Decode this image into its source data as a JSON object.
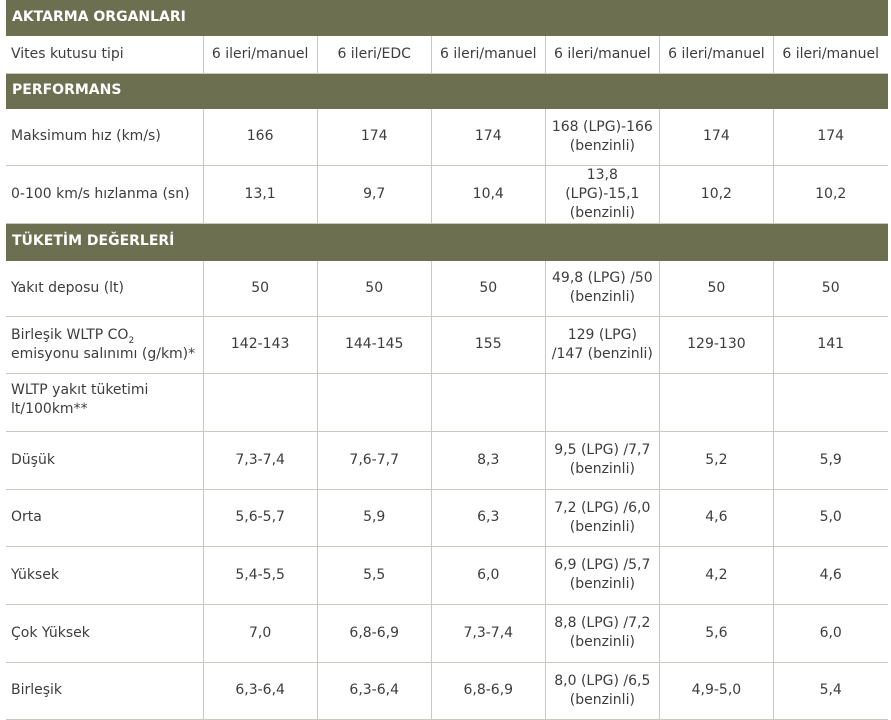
{
  "sections": [
    {
      "title": "AKTARMA ORGANLARI",
      "rows": [
        {
          "label": "Vites kutusu tipi",
          "values": [
            "6 ileri/manuel",
            "6 ileri/EDC",
            "6 ileri/manuel",
            "6 ileri/manuel",
            "6 ileri/manuel",
            "6 ileri/manuel"
          ]
        }
      ]
    },
    {
      "title": "PERFORMANS",
      "rows": [
        {
          "label": "Maksimum hız (km/s)",
          "values": [
            "166",
            "174",
            "174",
            "168 (LPG)-166 (benzinli)",
            "174",
            "174"
          ]
        },
        {
          "label": "0-100 km/s hızlanma (sn)",
          "values": [
            "13,1",
            "9,7",
            "10,4",
            "13,8 (LPG)-15,1 (benzinli)",
            "10,2",
            "10,2"
          ]
        }
      ]
    },
    {
      "title": "TÜKETİM DEĞERLERİ",
      "rows": [
        {
          "label": "Yakıt deposu (lt)",
          "values": [
            "50",
            "50",
            "50",
            "49,8 (LPG) /50 (benzinli)",
            "50",
            "50"
          ]
        },
        {
          "label_pre": "Birleşik WLTP CO",
          "label_sub": "2",
          "label_post": "emisyonu salınımı (g/km)*",
          "values": [
            "142-143",
            "144-145",
            "155",
            "129 (LPG) /147 (benzinli)",
            "129-130",
            "141"
          ]
        },
        {
          "label": "WLTP yakıt tüketimi lt/100km**",
          "values": [
            "",
            "",
            "",
            "",
            "",
            ""
          ]
        },
        {
          "label": "Düşük",
          "values": [
            "7,3-7,4",
            "7,6-7,7",
            "8,3",
            "9,5 (LPG) /7,7 (benzinli)",
            "5,2",
            "5,9"
          ]
        },
        {
          "label": "Orta",
          "values": [
            "5,6-5,7",
            "5,9",
            "6,3",
            "7,2 (LPG) /6,0 (benzinli)",
            "4,6",
            "5,0"
          ]
        },
        {
          "label": "Yüksek",
          "values": [
            "5,4-5,5",
            "5,5",
            "6,0",
            "6,9 (LPG) /5,7 (benzinli)",
            "4,2",
            "4,6"
          ]
        },
        {
          "label": "Çok Yüksek",
          "values": [
            "7,0",
            "6,8-6,9",
            "7,3-7,4",
            "8,8 (LPG) /7,2 (benzinli)",
            "5,6",
            "6,0"
          ]
        },
        {
          "label": "Birleşik",
          "values": [
            "6,3-6,4",
            "6,3-6,4",
            "6,8-6,9",
            "8,0 (LPG) /6,5 (benzinli)",
            "4,9-5,0",
            "5,4"
          ]
        }
      ]
    }
  ]
}
